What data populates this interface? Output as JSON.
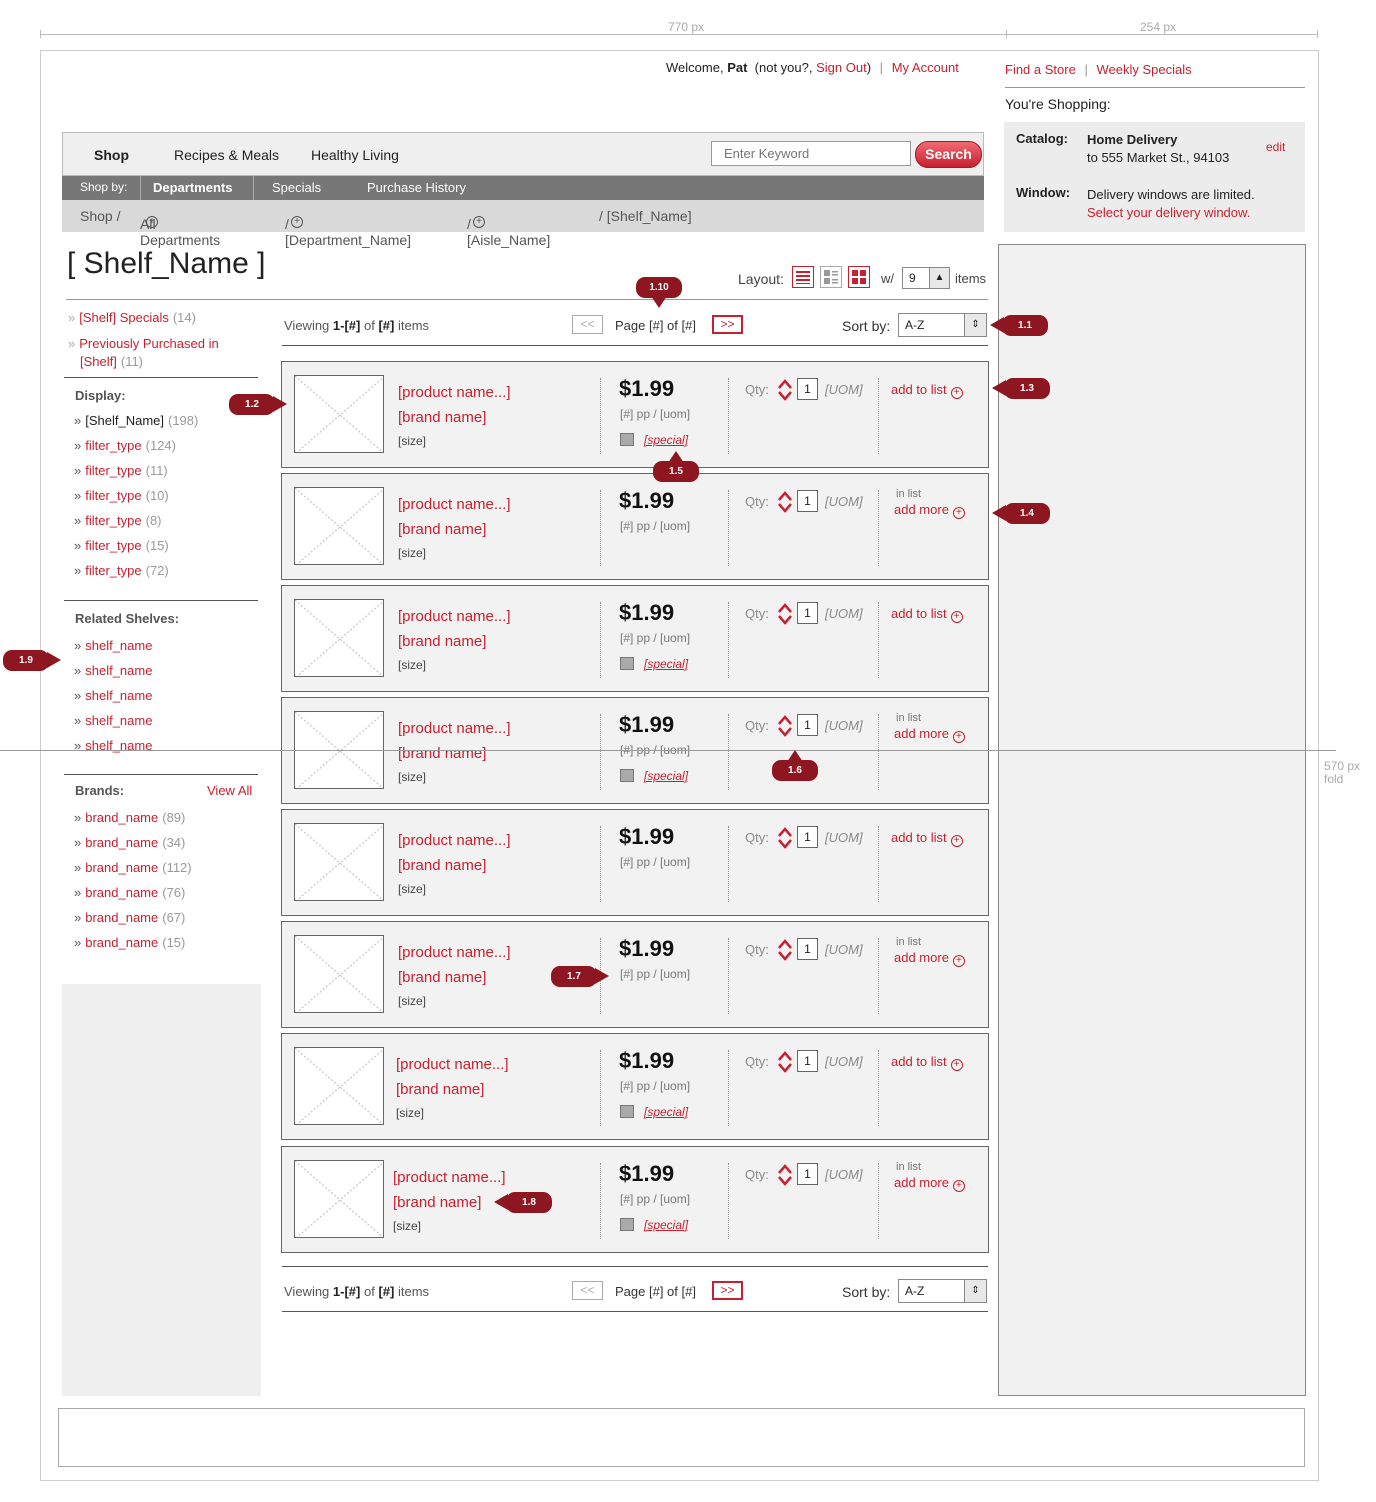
{
  "dimensions": {
    "main_width": "770 px",
    "side_width": "254 px",
    "fold": "570 px\nfold"
  },
  "header": {
    "welcome_prefix": "Welcome,",
    "user": "Pat",
    "not_you": "(not you?,",
    "sign_out": "Sign Out",
    "close_paren": ")",
    "sep": "|",
    "my_account": "My Account",
    "find_store": "Find a Store",
    "weekly_specials": "Weekly Specials",
    "youre_shopping": "You're Shopping:"
  },
  "shopping": {
    "catalog_label": "Catalog:",
    "catalog_value": "Home Delivery",
    "catalog_address": "to 555 Market St., 94103",
    "edit": "edit",
    "window_label": "Window:",
    "window_text": "Delivery windows are limited.",
    "window_link": "Select your delivery window."
  },
  "nav": {
    "tabs": [
      "Shop",
      "Recipes & Meals",
      "Healthy Living"
    ],
    "search_placeholder": "Enter Keyword",
    "search_button": "Search",
    "shop_by": "Shop by:",
    "subtabs": [
      "Departments",
      "Specials",
      "Purchase History"
    ],
    "breadcrumb": [
      "Shop /",
      "All Departments",
      "/ [Department_Name]",
      "/ [Aisle_Name]",
      "/ [Shelf_Name]"
    ]
  },
  "shelf": {
    "title": "[ Shelf_Name ]",
    "layout_label": "Layout:",
    "w_label": "w/",
    "items_per_page": "9",
    "items_label": "items"
  },
  "sidebar": {
    "specials": {
      "label": "[Shelf] Specials",
      "count": "(14)"
    },
    "prev_purchased": {
      "label1": "Previously Purchased in",
      "label2": "[Shelf]",
      "count": "(11)"
    },
    "display_heading": "Display:",
    "display_items": [
      {
        "label": "[Shelf_Name]",
        "count": "(198)"
      },
      {
        "label": "filter_type",
        "count": "(124)"
      },
      {
        "label": "filter_type",
        "count": "(11)"
      },
      {
        "label": "filter_type",
        "count": "(10)"
      },
      {
        "label": "filter_type",
        "count": "(8)"
      },
      {
        "label": "filter_type",
        "count": "(15)"
      },
      {
        "label": "filter_type",
        "count": "(72)"
      }
    ],
    "related_heading": "Related Shelves:",
    "related_items": [
      "shelf_name",
      "shelf_name",
      "shelf_name",
      "shelf_name",
      "shelf_name"
    ],
    "brands_heading": "Brands:",
    "view_all": "View All",
    "brand_items": [
      {
        "label": "brand_name",
        "count": "(89)"
      },
      {
        "label": "brand_name",
        "count": "(34)"
      },
      {
        "label": "brand_name",
        "count": "(112)"
      },
      {
        "label": "brand_name",
        "count": "(76)"
      },
      {
        "label": "brand_name",
        "count": "(67)"
      },
      {
        "label": "brand_name",
        "count": "(15)"
      }
    ],
    "bullet": "»"
  },
  "pagination": {
    "viewing": "Viewing",
    "range": "1-[#]",
    "of": "of",
    "total": "[#]",
    "items": "items",
    "prev": "<<",
    "page": "Page [#] of [#]",
    "next": ">>",
    "sort_label": "Sort by:",
    "sort_value": "A-Z"
  },
  "products": [
    {
      "name": "[product name...]",
      "brand": "[brand name]",
      "size": "[size]",
      "price": "$1.99",
      "unit_price": "[#] pp / [uom]",
      "special": "[special]",
      "qty_label": "Qty:",
      "qty": "1",
      "uom": "[UOM]",
      "in_list": false,
      "action": "add to list"
    },
    {
      "name": "[product name...]",
      "brand": "[brand name]",
      "size": "[size]",
      "price": "$1.99",
      "unit_price": "[#] pp / [uom]",
      "special": "",
      "qty_label": "Qty:",
      "qty": "1",
      "uom": "[UOM]",
      "in_list": true,
      "in_list_label": "in list",
      "action": "add more"
    },
    {
      "name": "[product name...]",
      "brand": "[brand name]",
      "size": "[size]",
      "price": "$1.99",
      "unit_price": "[#] pp / [uom]",
      "special": "[special]",
      "qty_label": "Qty:",
      "qty": "1",
      "uom": "[UOM]",
      "in_list": false,
      "action": "add to list"
    },
    {
      "name": "[product name...]",
      "brand": "[brand name]",
      "size": "[size]",
      "price": "$1.99",
      "unit_price": "[#] pp / [uom]",
      "special": "[special]",
      "qty_label": "Qty:",
      "qty": "1",
      "uom": "[UOM]",
      "in_list": true,
      "in_list_label": "in list",
      "action": "add more"
    },
    {
      "name": "[product name...]",
      "brand": "[brand name]",
      "size": "[size]",
      "price": "$1.99",
      "unit_price": "[#] pp / [uom]",
      "special": "",
      "qty_label": "Qty:",
      "qty": "1",
      "uom": "[UOM]",
      "in_list": false,
      "action": "add to list"
    },
    {
      "name": "[product name...]",
      "brand": "[brand name]",
      "size": "[size]",
      "price": "$1.99",
      "unit_price": "[#] pp / [uom]",
      "special": "",
      "qty_label": "Qty:",
      "qty": "1",
      "uom": "[UOM]",
      "in_list": true,
      "in_list_label": "in list",
      "action": "add more"
    },
    {
      "name": "[product name...]",
      "brand": "[brand name]",
      "size": "[size]",
      "price": "$1.99",
      "unit_price": "[#] pp / [uom]",
      "special": "[special]",
      "qty_label": "Qty:",
      "qty": "1",
      "uom": "[UOM]",
      "in_list": false,
      "action": "add to list"
    },
    {
      "name": "[product name...]",
      "brand": "[brand name]",
      "size": "[size]",
      "price": "$1.99",
      "unit_price": "[#] pp / [uom]",
      "special": "[special]",
      "qty_label": "Qty:",
      "qty": "1",
      "uom": "[UOM]",
      "in_list": true,
      "in_list_label": "in list",
      "action": "add more"
    }
  ],
  "callouts": [
    "1.1",
    "1.2",
    "1.3",
    "1.4",
    "1.5",
    "1.6",
    "1.7",
    "1.8",
    "1.9",
    "1.10"
  ],
  "colors": {
    "accent": "#c8202f",
    "callout": "#8e1620",
    "nav_dark": "#777777",
    "nav_light": "#efefef"
  },
  "icons": {
    "add": "plus-circle-icon",
    "qty": "stepper-arrows-icon",
    "layout": [
      "list-layout-icon",
      "detail-layout-icon",
      "grid-layout-icon"
    ]
  }
}
